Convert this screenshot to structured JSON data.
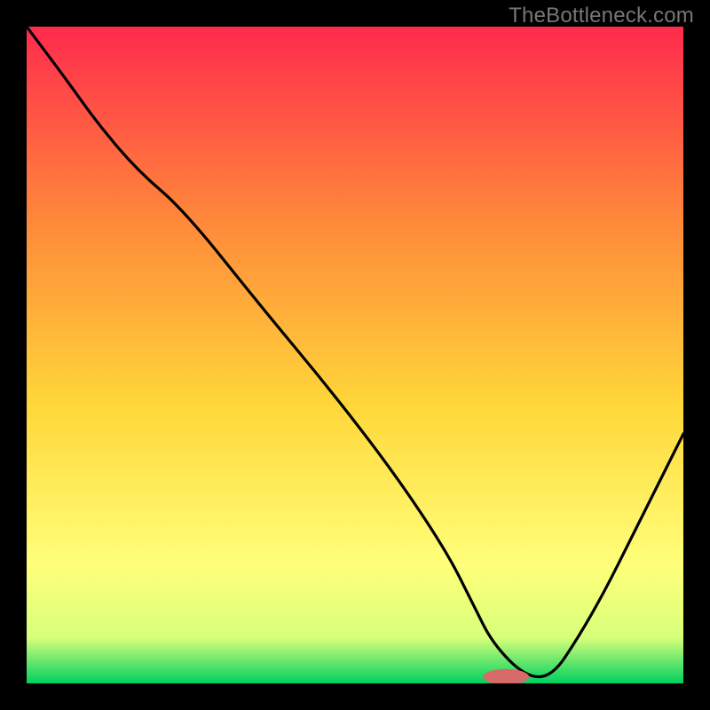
{
  "watermark": "TheBottleneck.com",
  "chart_data": {
    "type": "line",
    "title": "",
    "xlabel": "",
    "ylabel": "",
    "xlim": [
      0,
      100
    ],
    "ylim": [
      0,
      100
    ],
    "grid": false,
    "legend": false,
    "gradient_colors": {
      "top": "#ff2a4d",
      "upper_mid": "#ff8a3a",
      "mid": "#ffd83a",
      "low": "#ffff7a",
      "near_bottom": "#d8ff7a",
      "bottom": "#00d060"
    },
    "marker": {
      "x": 73,
      "y": 1,
      "color": "#d86a6a",
      "rx": 3.5,
      "ry": 1.2
    },
    "x": [
      0,
      6,
      11,
      17,
      24,
      36,
      46,
      56,
      64,
      68,
      71,
      76,
      80,
      84,
      88,
      92,
      96,
      100
    ],
    "values": [
      100,
      92,
      85,
      78,
      72,
      57,
      45,
      32,
      20,
      12,
      6,
      1,
      1,
      7,
      14,
      22,
      30,
      38
    ]
  }
}
